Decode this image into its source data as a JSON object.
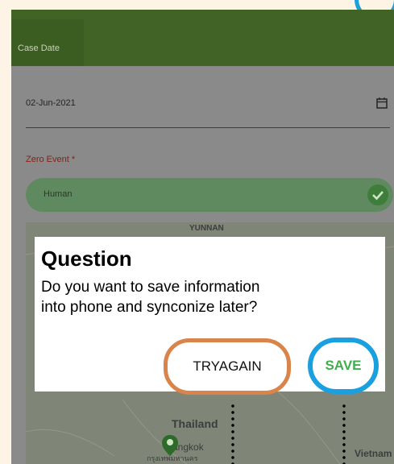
{
  "header": {
    "tab_label": "Case Date"
  },
  "form": {
    "date_value": "02-Jun-2021",
    "zero_event_label": "Zero Event *",
    "zero_event_value": "Human"
  },
  "map": {
    "labels": {
      "yunnan": "YUNNAN",
      "thailand": "Thailand",
      "bangkok": "Bangkok",
      "bangkok_thai": "กรุงเทพมหานคร",
      "vietnam": "Vietnam"
    }
  },
  "dialog": {
    "title": "Question",
    "message": "Do you want to save information into phone and synconize later?",
    "try_again_label": "TRYAGAIN",
    "save_label": "SAVE"
  },
  "colors": {
    "header_green": "#416426",
    "annotation_orange": "#d8844a",
    "annotation_blue": "#1aa0df",
    "save_green": "#3fae4e"
  }
}
